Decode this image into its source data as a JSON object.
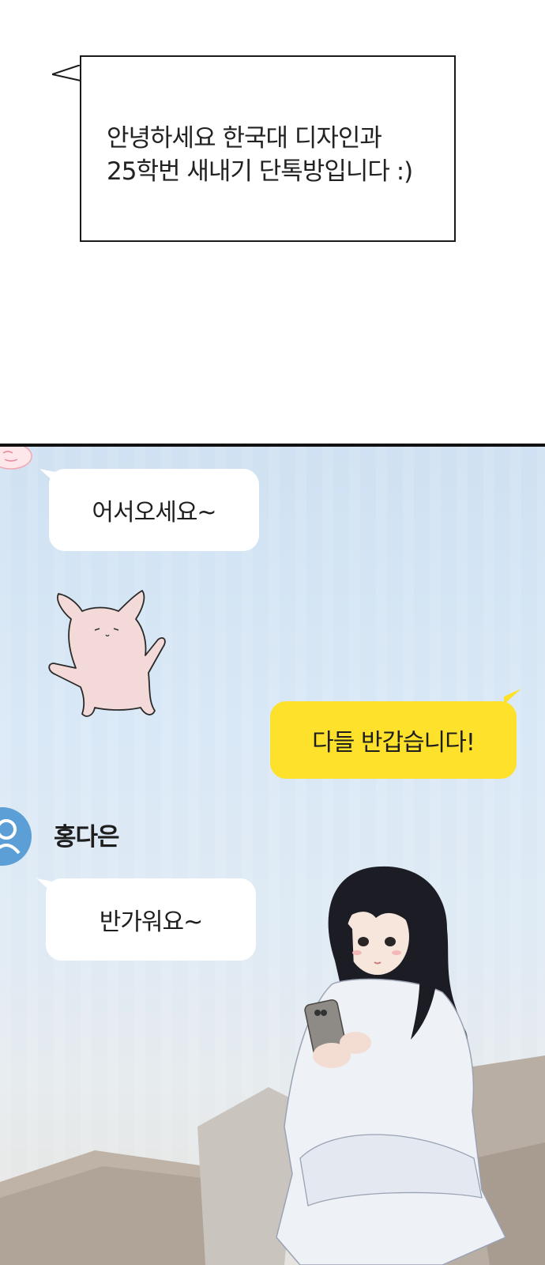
{
  "narration": {
    "line1": "안녕하세요 한국대 디자인과",
    "line2": "25학번 새내기 단톡방입니다 :)"
  },
  "chat": {
    "messages": [
      {
        "text": "어서오세요~",
        "side": "left",
        "color": "#ffffff"
      },
      {
        "text": "다들 반갑습니다!",
        "side": "right",
        "color": "#fde12b"
      },
      {
        "text": "반가워요~",
        "side": "left",
        "color": "#ffffff"
      }
    ],
    "sender": {
      "name": "홍다은",
      "avatar_color": "#5b9fd6"
    },
    "sticker": "pink-rabbit-sticker"
  }
}
